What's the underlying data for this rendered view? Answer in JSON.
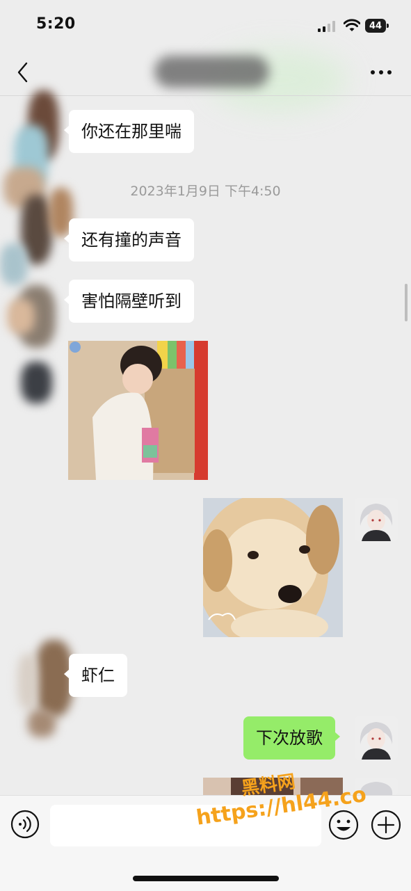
{
  "status_bar": {
    "time": "5:20",
    "battery": "44"
  },
  "nav": {
    "title": ""
  },
  "messages": {
    "m1": "你还在那里喘",
    "timestamp": "2023年1月9日 下午4:50",
    "m2": "还有撞的声音",
    "m3": "害怕隔壁听到",
    "m4": "虾仁",
    "m5": "下次放歌"
  },
  "watermark": {
    "line1": "黑料网",
    "line2": "https://hl44.co"
  },
  "colors": {
    "background": "#ededed",
    "sent_bubble": "#95ec69",
    "received_bubble": "#ffffff",
    "watermark": "#f5a21c"
  }
}
